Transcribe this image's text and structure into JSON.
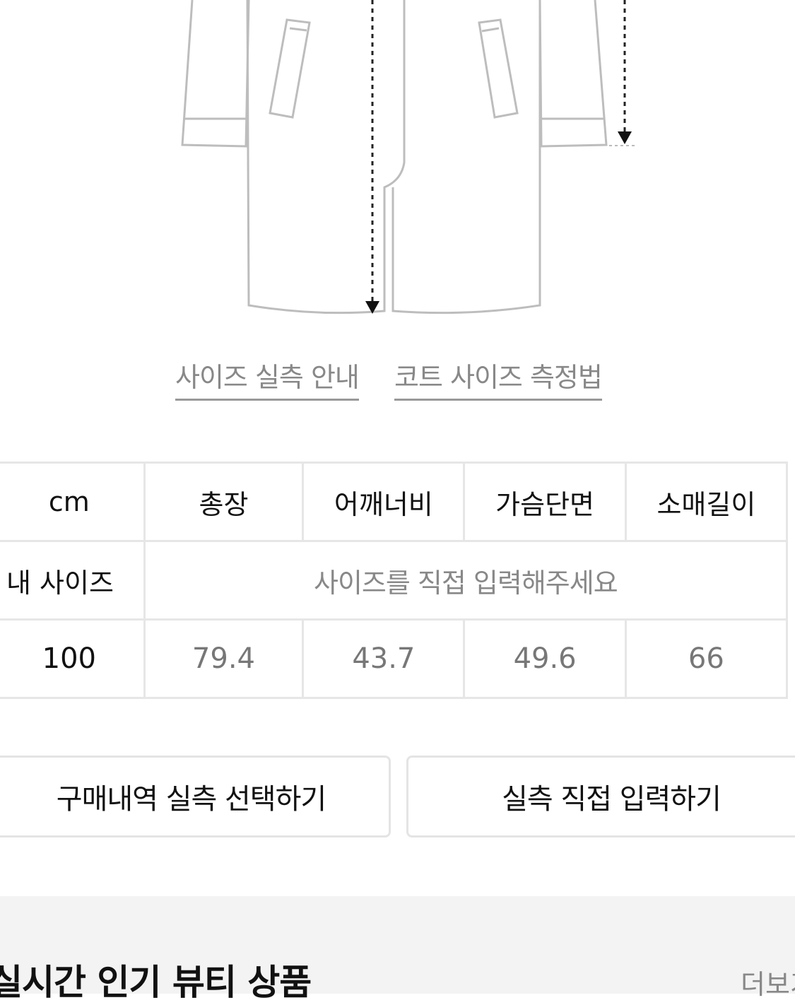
{
  "links": {
    "size_guide": "사이즈 실측 안내",
    "coat_measure": "코트 사이즈 측정법"
  },
  "table": {
    "unit_label": "cm",
    "columns": [
      "총장",
      "어깨너비",
      "가슴단면",
      "소매길이"
    ],
    "my_size_label": "내 사이즈",
    "my_size_placeholder": "사이즈를 직접 입력해주세요",
    "row": {
      "size": "100",
      "values": [
        "79.4",
        "43.7",
        "49.6",
        "66"
      ]
    }
  },
  "buttons": {
    "purchase_history": "구매내역 실측 선택하기",
    "manual_input": "실측 직접 입력하기"
  },
  "section": {
    "title": "실시간 인기 뷰티 상품",
    "more": "더보기"
  },
  "colors": {
    "border": "#e6e6e6",
    "muted_text": "#888888",
    "band_bg": "#f3f3f3"
  }
}
